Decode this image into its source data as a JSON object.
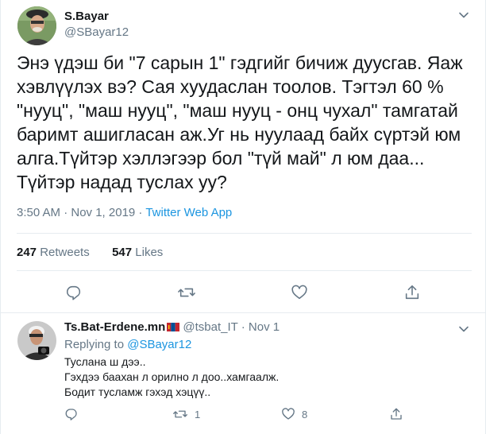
{
  "tweet": {
    "author_name": "S.Bayar",
    "author_handle": "@SBayar12",
    "text_lines": [
      "Энэ үдэш би \"7 сарын 1\" гэдгийг бичиж дуусгав. Яаж",
      "хэвлүүлэх вэ? Сая хуудаслан тоолов. Тэгтэл 60 %",
      "\"нууц\", \"маш нууц\", \"маш нууц - онц чухал\"  тамгатай",
      "баримт ашигласан аж.Уг нь нуулаад байх сүртэй юм",
      "алга.Түйтэр хэллэгээр бол \"түй май\" л юм даа...",
      "Түйтэр надад туслах уу?"
    ],
    "timestamp": "3:50 AM · Nov 1, 2019 · ",
    "source": "Twitter Web App",
    "retweet_count": "247",
    "retweet_label": " Retweets",
    "like_count": "547",
    "like_label": " Likes"
  },
  "reply": {
    "author_name": "Ts.Bat-Erdene.mn",
    "meta": " @tsbat_IT · Nov 1",
    "replying_label": "Replying to ",
    "replying_to": "@SBayar12",
    "text_lines": [
      "Туслана ш дээ..",
      "Гэхдээ баахан л орилно л доо..хамгаалж.",
      "Бодит тусламж гэхэд хэцүү.."
    ],
    "retweet_count": "1",
    "like_count": "8"
  },
  "colors": {
    "text": "#14171a",
    "secondary": "#657786",
    "link": "#1b95e0",
    "divider": "#e6ecf0"
  },
  "icons": [
    "chevron-down-icon",
    "reply-icon",
    "retweet-icon",
    "heart-icon",
    "share-icon",
    "mongolian-flag-icon"
  ]
}
